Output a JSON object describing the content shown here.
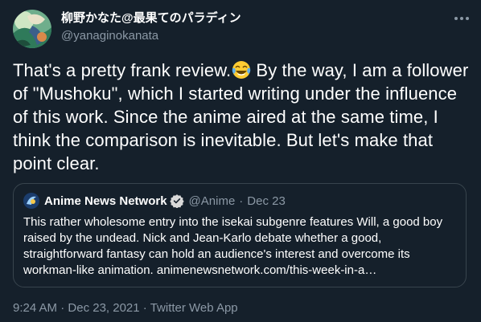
{
  "author": {
    "display_name": "柳野かなた@最果てのパラディン",
    "handle": "@yanaginokanata",
    "avatar_icon": "avatar-illustration"
  },
  "tweet": {
    "text_part1": "That's a pretty frank review.",
    "emoji_icon": "face-with-tears-of-joy-icon",
    "text_part2": " By the way, I am a follower of \"Mushoku\", which I started writing under the influence of this work. Since the anime aired at the same time, I think the comparison is inevitable. But let's make that point clear."
  },
  "quote": {
    "name": "Anime News Network",
    "handle": "@Anime",
    "separator": "·",
    "date": "Dec 23",
    "text": "This rather wholesome entry into the isekai subgenre features Will, a good boy raised by the undead. Nick and Jean-Karlo debate whether a good, straightforward fantasy can hold an audience's interest and overcome its workman-like animation. animenewsnetwork.com/this-week-in-a…"
  },
  "meta": {
    "time": "9:24 AM",
    "sep1": " · ",
    "date": "Dec 23, 2021",
    "sep2": " · ",
    "source": "Twitter Web App"
  },
  "colors": {
    "background": "#15202b",
    "text": "#ffffff",
    "muted": "#8b98a5",
    "border": "#38444d",
    "verified": "#1d9bf0"
  }
}
